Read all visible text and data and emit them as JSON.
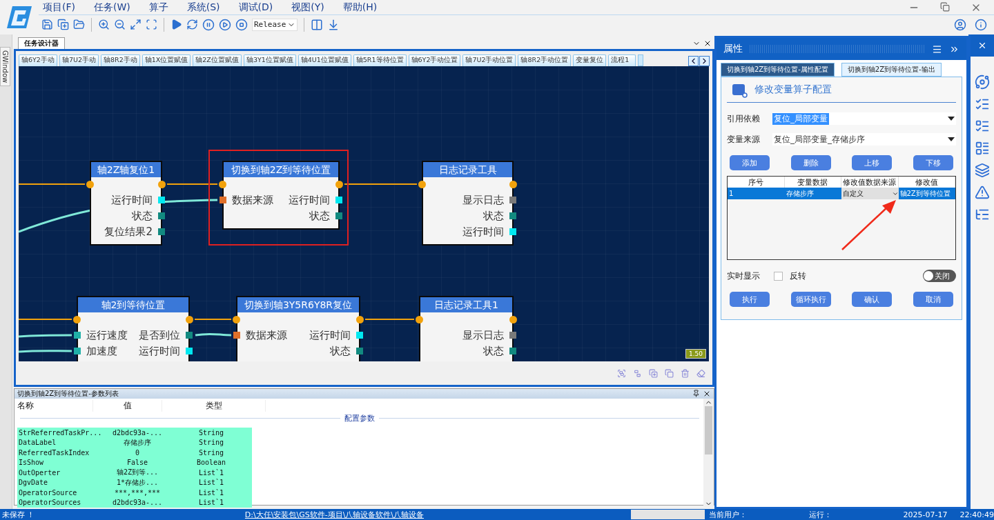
{
  "menu": [
    "项目(F)",
    "任务(W)",
    "算子",
    "系统(S)",
    "调试(D)",
    "视图(Y)",
    "帮助(H)"
  ],
  "build_config": "Release",
  "side_tab": "GWindow",
  "designer": {
    "tab": "任务设计器",
    "operator_tabs": [
      {
        "label": "轴6Y2手动"
      },
      {
        "label": "轴7U2手动"
      },
      {
        "label": "轴8R2手动"
      },
      {
        "label": "轴1X位置赋值"
      },
      {
        "label": "轴2Z位置赋值"
      },
      {
        "label": "轴3Y1位置赋值"
      },
      {
        "label": "轴4U1位置赋值"
      },
      {
        "label": "轴5R1等待位置"
      },
      {
        "label": "轴6Y2手动位置"
      },
      {
        "label": "轴7U2手动位置"
      },
      {
        "label": "轴8R2手动位置"
      },
      {
        "label": "变量复位"
      },
      {
        "label": "流程1"
      }
    ],
    "zoom": "1.50",
    "nodes": [
      {
        "title": "轴2Z轴复位1",
        "selected": false,
        "outputs": [
          {
            "label": "运行时间",
            "color": "#00e8f0"
          },
          {
            "label": "状态",
            "color": "#128a80"
          },
          {
            "label": "复位结果2",
            "color": "#128a80"
          }
        ]
      },
      {
        "title": "切换到轴2Z到等待位置",
        "selected": true,
        "inputs": [
          {
            "label": "数据来源",
            "color": "#e0702a"
          }
        ],
        "outputs": [
          {
            "label": "运行时间",
            "color": "#00e8f0"
          },
          {
            "label": "状态",
            "color": "#128a80"
          }
        ]
      },
      {
        "title": "日志记录工具",
        "selected": false,
        "outputs": [
          {
            "label": "显示日志",
            "color": "#7a7a7a"
          },
          {
            "label": "状态",
            "color": "#128a80"
          },
          {
            "label": "运行时间",
            "color": "#00e8f0"
          }
        ]
      },
      {
        "title": "轴2到等待位置",
        "selected": false,
        "inputs": [
          {
            "label": "运行速度",
            "color": "#20b0a8"
          },
          {
            "label": "加速度",
            "color": "#20b0a8"
          }
        ],
        "outputs": [
          {
            "label": "是否到位",
            "color": "#128a80"
          },
          {
            "label": "运行时间",
            "color": "#00e8f0"
          }
        ]
      },
      {
        "title": "切换到轴3Y5R6Y8R复位",
        "selected": false,
        "inputs": [
          {
            "label": "数据来源",
            "color": "#e0702a"
          }
        ],
        "outputs": [
          {
            "label": "运行时间",
            "color": "#00e8f0"
          },
          {
            "label": "状态",
            "color": "#128a80"
          }
        ]
      },
      {
        "title": "日志记录工具1",
        "selected": false,
        "outputs": [
          {
            "label": "显示日志",
            "color": "#7a7a7a"
          },
          {
            "label": "状态",
            "color": "#128a80"
          }
        ]
      }
    ]
  },
  "params": {
    "title": "切换到轴2Z到等待位置-参数列表",
    "columns": [
      "名称",
      "值",
      "类型"
    ],
    "group": "配置参数",
    "rows": [
      {
        "name": "StrReferredTaskPr...",
        "value": "d2bdc93a-...",
        "type": "String"
      },
      {
        "name": "DataLabel",
        "value": "存储步序",
        "type": "String"
      },
      {
        "name": "ReferredTaskIndex",
        "value": "0",
        "type": "String"
      },
      {
        "name": "IsShow",
        "value": "False",
        "type": "Boolean"
      },
      {
        "name": "OutOperter",
        "value": "轴2Z到等...",
        "type": "List`1"
      },
      {
        "name": "DgvDate",
        "value": "1*存储步...",
        "type": "List`1"
      },
      {
        "name": "OperatorSource",
        "value": "***,***,***",
        "type": "List`1"
      },
      {
        "name": "OperatorSources",
        "value": "d2bdc93a-...",
        "type": "List`1"
      }
    ]
  },
  "properties": {
    "title": "属性",
    "tabs": [
      {
        "label": "切换到轴2Z到等待位置-属性配置",
        "selected": true
      },
      {
        "label": "切换到轴2Z到等待位置-输出",
        "selected": false
      }
    ],
    "heading": "修改变量算子配置",
    "fields": [
      {
        "label": "引用依赖",
        "value": "复位_局部变量",
        "highlighted": true
      },
      {
        "label": "变量来源",
        "value": "复位_局部变量_存储步序",
        "highlighted": false
      }
    ],
    "actions": [
      "添加",
      "删除",
      "上移",
      "下移"
    ],
    "grid": {
      "columns": [
        "序号",
        "变量数据",
        "修改值数据来源",
        "修改值"
      ],
      "rows": [
        {
          "selected": true,
          "cells": [
            {
              "kind": "text",
              "text": "1"
            },
            {
              "kind": "text",
              "text": "存储步序"
            },
            {
              "kind": "combo",
              "text": "自定义"
            },
            {
              "kind": "text",
              "text": "轴2Z到等待位置"
            }
          ]
        }
      ]
    },
    "realtime_label": "实时显示",
    "invert": {
      "label": "反转",
      "checked": false
    },
    "toggle": {
      "label": "关闭",
      "on": false
    },
    "buttons": [
      "执行",
      "循环执行",
      "确认",
      "取消"
    ]
  },
  "status_bar": {
    "save_state": "未保存 ！",
    "path": "D:\\大任\\安装包\\GS软件-项目\\八轴设备软件\\八轴设备",
    "user_label": "当前用户：",
    "run_label": "运行：",
    "date": "2025-07-17",
    "time": "22:40:49"
  }
}
